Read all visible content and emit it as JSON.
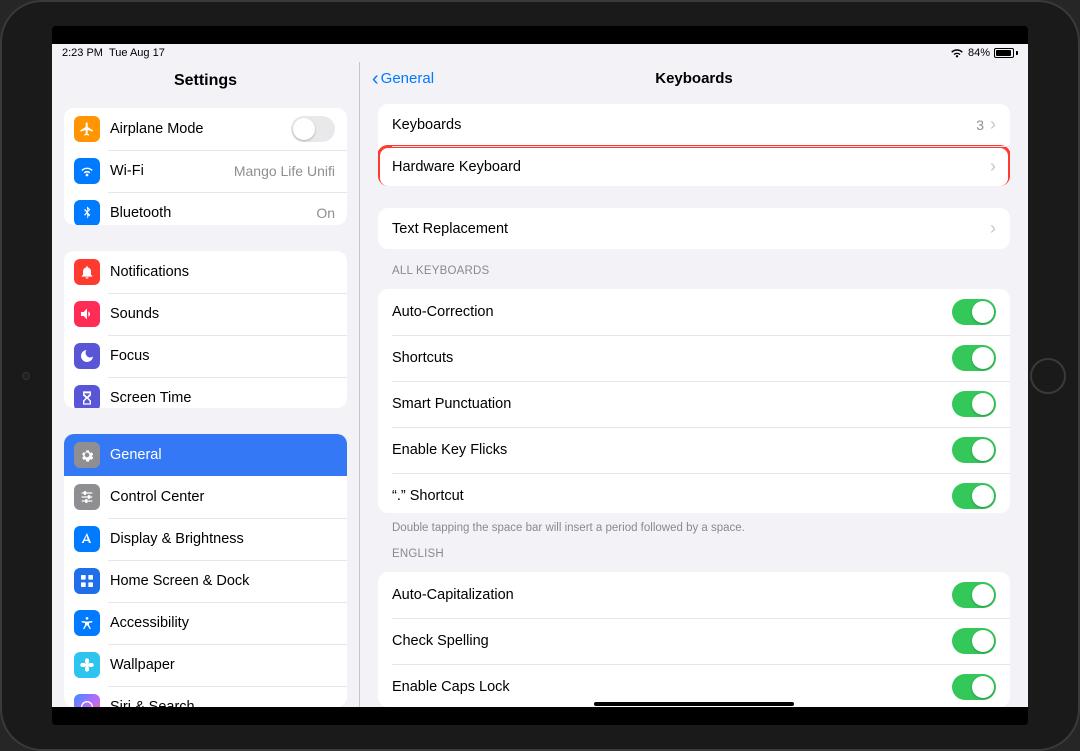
{
  "status": {
    "time": "2:23 PM",
    "date": "Tue Aug 17",
    "battery_pct": "84%"
  },
  "sidebar": {
    "title": "Settings",
    "group1": {
      "airplane": {
        "label": "Airplane Mode"
      },
      "wifi": {
        "label": "Wi-Fi",
        "detail": "Mango Life Unifi"
      },
      "bluetooth": {
        "label": "Bluetooth",
        "detail": "On"
      }
    },
    "group2": {
      "notifications": {
        "label": "Notifications"
      },
      "sounds": {
        "label": "Sounds"
      },
      "focus": {
        "label": "Focus"
      },
      "screen_time": {
        "label": "Screen Time"
      }
    },
    "group3": {
      "general": {
        "label": "General"
      },
      "control_center": {
        "label": "Control Center"
      },
      "display": {
        "label": "Display & Brightness"
      },
      "home_screen": {
        "label": "Home Screen & Dock"
      },
      "accessibility": {
        "label": "Accessibility"
      },
      "wallpaper": {
        "label": "Wallpaper"
      },
      "siri": {
        "label": "Siri & Search"
      }
    }
  },
  "main": {
    "back": "General",
    "title": "Keyboards",
    "group1": {
      "keyboards": {
        "label": "Keyboards",
        "count": "3"
      },
      "hardware": {
        "label": "Hardware Keyboard"
      }
    },
    "group2": {
      "text_replacement": {
        "label": "Text Replacement"
      }
    },
    "section_all": "ALL KEYBOARDS",
    "group3": {
      "auto_correction": {
        "label": "Auto-Correction"
      },
      "shortcuts": {
        "label": "Shortcuts"
      },
      "smart_punctuation": {
        "label": "Smart Punctuation"
      },
      "enable_key_flicks": {
        "label": "Enable Key Flicks"
      },
      "period_shortcut": {
        "label": "“.” Shortcut"
      }
    },
    "footer1": "Double tapping the space bar will insert a period followed by a space.",
    "section_english": "ENGLISH",
    "group4": {
      "auto_cap": {
        "label": "Auto-Capitalization"
      },
      "check_spelling": {
        "label": "Check Spelling"
      },
      "caps_lock": {
        "label": "Enable Caps Lock"
      }
    }
  }
}
